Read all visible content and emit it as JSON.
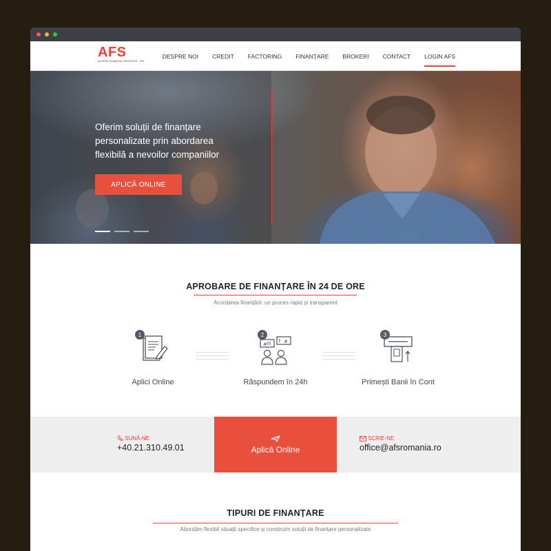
{
  "brand": {
    "name": "AFS",
    "tagline": "ACCESS FINANCIAL SERVICES - IFN"
  },
  "nav": {
    "items": [
      {
        "label": "DESPRE NOI"
      },
      {
        "label": "CREDIT"
      },
      {
        "label": "FACTORING"
      },
      {
        "label": "FINANȚARE"
      },
      {
        "label": "BROKERI"
      },
      {
        "label": "CONTACT"
      },
      {
        "label": "LOGIN AFS"
      }
    ]
  },
  "hero": {
    "headline_line1": "Oferim soluții de finanțare",
    "headline_line2": "personalizate prin abordarea",
    "headline_line3": "flexibilă a nevoilor companiilor",
    "button_label": "APLICĂ ONLINE"
  },
  "approval": {
    "title": "APROBARE DE FINANȚARE ÎN 24 DE ORE",
    "subtitle": "Acordarea finanțării: un proces rapid și transparent",
    "steps": [
      {
        "number": "1",
        "label": "Aplici Online",
        "icon": "document-pen-icon"
      },
      {
        "number": "2",
        "label": "Răspundem în 24h",
        "icon": "team-chat-icon"
      },
      {
        "number": "3",
        "label": "Primești Banii în Cont",
        "icon": "atm-card-icon"
      }
    ]
  },
  "cta": {
    "phone_label": "SUNĂ-NE",
    "phone_value": "+40.21.310.49.01",
    "apply_label": "Aplică Online",
    "email_label": "SCRIE-NE",
    "email_value": "office@afsromania.ro"
  },
  "types": {
    "title": "TIPURI DE FINANȚARE",
    "subtitle": "Abordăm flexibil situații specifice și construim soluții de finanțare personalizate"
  },
  "colors": {
    "accent": "#e8413a",
    "button": "#e8503d",
    "band": "#eeeeee",
    "page_bg": "#251d0f"
  }
}
